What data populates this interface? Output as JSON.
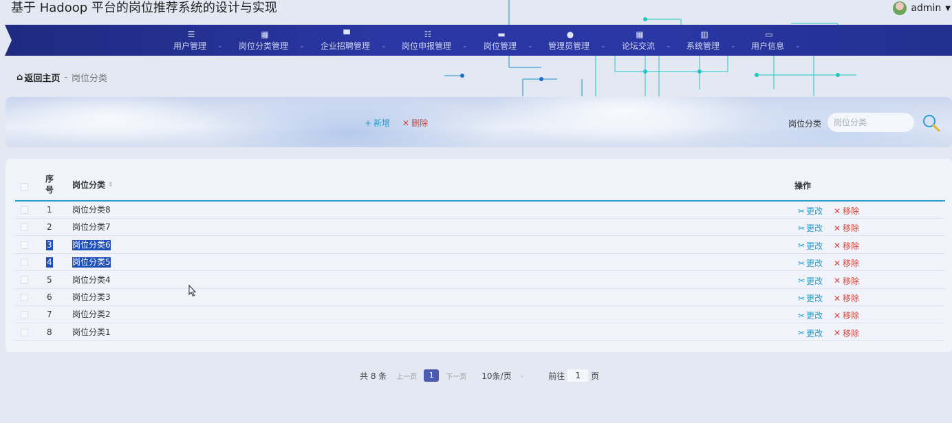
{
  "app": {
    "title": "基于 Hadoop 平台的岗位推荐系统的设计与实现",
    "username": "admin"
  },
  "nav": {
    "items": [
      {
        "label": "用户管理",
        "icon": "list-icon"
      },
      {
        "label": "岗位分类管理",
        "icon": "grid-icon"
      },
      {
        "label": "企业招聘管理",
        "icon": "monitor-icon"
      },
      {
        "label": "岗位申报管理",
        "icon": "sliders-icon"
      },
      {
        "label": "岗位管理",
        "icon": "ticket-icon"
      },
      {
        "label": "管理员管理",
        "icon": "user-icon"
      },
      {
        "label": "论坛交流",
        "icon": "grid-icon"
      },
      {
        "label": "系统管理",
        "icon": "bar-chart-icon"
      },
      {
        "label": "用户信息",
        "icon": "card-icon"
      }
    ]
  },
  "breadcrumb": {
    "home": "返回主页",
    "separator": "-",
    "current": "岗位分类"
  },
  "toolbar": {
    "add_label": "新增",
    "delete_label": "删除",
    "search_label": "岗位分类",
    "search_placeholder": "岗位分类"
  },
  "table": {
    "headers": {
      "no": "序号",
      "category": "岗位分类",
      "actions": "操作"
    },
    "edit_label": "更改",
    "remove_label": "移除",
    "rows": [
      {
        "no": "1",
        "category": "岗位分类8",
        "selected": false
      },
      {
        "no": "2",
        "category": "岗位分类7",
        "selected": false
      },
      {
        "no": "3",
        "category": "岗位分类6",
        "selected": true
      },
      {
        "no": "4",
        "category": "岗位分类5",
        "selected": true
      },
      {
        "no": "5",
        "category": "岗位分类4",
        "selected": false
      },
      {
        "no": "6",
        "category": "岗位分类3",
        "selected": false
      },
      {
        "no": "7",
        "category": "岗位分类2",
        "selected": false
      },
      {
        "no": "8",
        "category": "岗位分类1",
        "selected": false
      }
    ]
  },
  "pagination": {
    "total_label": "共 8 条",
    "prev_label": "上一页",
    "current_page": "1",
    "next_label": "下一页",
    "page_size_label": "10条/页",
    "goto_label": "前往",
    "goto_value": "1",
    "page_suffix": "页"
  },
  "colors": {
    "nav_bg": "#2a36a3",
    "accent": "#2a9dcb",
    "danger": "#d6463c",
    "selection": "#1e4fb8"
  }
}
